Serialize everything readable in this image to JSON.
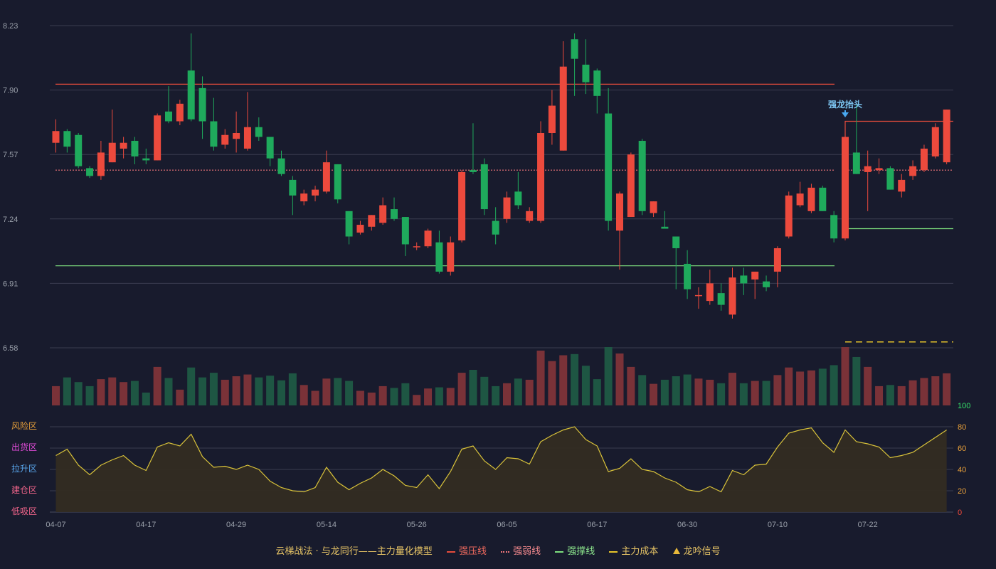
{
  "chart_data": {
    "type": "candlestick",
    "price_axis": {
      "ticks": [
        "8.23",
        "7.90",
        "7.57",
        "7.24",
        "6.91",
        "6.58"
      ],
      "range": [
        6.58,
        8.23
      ]
    },
    "x_ticks": [
      "04-07",
      "04-17",
      "04-29",
      "05-14",
      "05-26",
      "06-05",
      "06-17",
      "06-30",
      "07-10",
      "07-22"
    ],
    "x_tick_at_index": [
      0,
      8,
      16,
      24,
      32,
      40,
      48,
      56,
      64,
      72
    ],
    "candles": [
      [
        7.63,
        7.69,
        7.75,
        7.58
      ],
      [
        7.69,
        7.61,
        7.7,
        7.58
      ],
      [
        7.67,
        7.51,
        7.68,
        7.5
      ],
      [
        7.5,
        7.46,
        7.51,
        7.45
      ],
      [
        7.46,
        7.58,
        7.64,
        7.44
      ],
      [
        7.53,
        7.63,
        7.8,
        7.53
      ],
      [
        7.6,
        7.63,
        7.66,
        7.55
      ],
      [
        7.64,
        7.56,
        7.66,
        7.52
      ],
      [
        7.55,
        7.54,
        7.6,
        7.52
      ],
      [
        7.54,
        7.77,
        7.78,
        7.54
      ],
      [
        7.79,
        7.74,
        7.92,
        7.73
      ],
      [
        7.74,
        7.83,
        7.85,
        7.72
      ],
      [
        8.0,
        7.75,
        8.19,
        7.74
      ],
      [
        7.91,
        7.74,
        7.97,
        7.65
      ],
      [
        7.74,
        7.61,
        7.86,
        7.59
      ],
      [
        7.62,
        7.67,
        7.7,
        7.6
      ],
      [
        7.65,
        7.68,
        7.79,
        7.58
      ],
      [
        7.6,
        7.71,
        7.89,
        7.59
      ],
      [
        7.71,
        7.66,
        7.76,
        7.64
      ],
      [
        7.66,
        7.55,
        7.66,
        7.51
      ],
      [
        7.55,
        7.47,
        7.59,
        7.46
      ],
      [
        7.44,
        7.36,
        7.46,
        7.26
      ],
      [
        7.33,
        7.37,
        7.39,
        7.31
      ],
      [
        7.36,
        7.39,
        7.41,
        7.33
      ],
      [
        7.38,
        7.53,
        7.59,
        7.37
      ],
      [
        7.52,
        7.34,
        7.52,
        7.32
      ],
      [
        7.28,
        7.15,
        7.28,
        7.11
      ],
      [
        7.17,
        7.21,
        7.23,
        7.16
      ],
      [
        7.2,
        7.26,
        7.26,
        7.18
      ],
      [
        7.22,
        7.31,
        7.35,
        7.21
      ],
      [
        7.29,
        7.24,
        7.35,
        7.23
      ],
      [
        7.25,
        7.11,
        7.25,
        7.05
      ],
      [
        7.1,
        7.1,
        7.12,
        7.08
      ],
      [
        7.1,
        7.18,
        7.19,
        7.09
      ],
      [
        7.12,
        6.97,
        7.18,
        6.96
      ],
      [
        6.97,
        7.12,
        7.15,
        6.95
      ],
      [
        7.13,
        7.48,
        7.49,
        7.12
      ],
      [
        7.49,
        7.48,
        7.73,
        7.47
      ],
      [
        7.52,
        7.29,
        7.55,
        7.26
      ],
      [
        7.23,
        7.16,
        7.3,
        7.11
      ],
      [
        7.24,
        7.35,
        7.38,
        7.22
      ],
      [
        7.38,
        7.31,
        7.48,
        7.29
      ],
      [
        7.23,
        7.28,
        7.3,
        7.22
      ],
      [
        7.23,
        7.68,
        7.74,
        7.22
      ],
      [
        7.68,
        7.82,
        7.9,
        7.62
      ],
      [
        7.59,
        8.02,
        8.15,
        7.59
      ],
      [
        8.16,
        8.06,
        8.19,
        7.87
      ],
      [
        8.03,
        7.94,
        8.16,
        7.88
      ],
      [
        8.0,
        7.87,
        8.01,
        7.78
      ],
      [
        7.78,
        7.23,
        7.91,
        7.18
      ],
      [
        7.18,
        7.37,
        7.38,
        6.98
      ],
      [
        7.25,
        7.57,
        7.58,
        7.25
      ],
      [
        7.64,
        7.28,
        7.65,
        7.26
      ],
      [
        7.27,
        7.33,
        7.33,
        7.25
      ],
      [
        7.2,
        7.19,
        7.28,
        7.19
      ],
      [
        7.15,
        7.09,
        7.15,
        6.88
      ],
      [
        7.01,
        6.88,
        7.08,
        6.83
      ],
      [
        6.85,
        6.85,
        6.89,
        6.78
      ],
      [
        6.82,
        6.91,
        6.98,
        6.8
      ],
      [
        6.86,
        6.8,
        6.91,
        6.77
      ],
      [
        6.75,
        6.94,
        6.99,
        6.73
      ],
      [
        6.95,
        6.91,
        6.99,
        6.85
      ],
      [
        6.93,
        6.97,
        6.97,
        6.83
      ],
      [
        6.92,
        6.89,
        6.95,
        6.87
      ],
      [
        6.97,
        7.09,
        7.1,
        6.89
      ],
      [
        7.15,
        7.36,
        7.38,
        7.14
      ],
      [
        7.31,
        7.37,
        7.43,
        7.3
      ],
      [
        7.28,
        7.4,
        7.42,
        7.27
      ],
      [
        7.4,
        7.28,
        7.41,
        7.28
      ],
      [
        7.26,
        7.14,
        7.28,
        7.12
      ],
      [
        7.14,
        7.66,
        7.68,
        7.13
      ],
      [
        7.58,
        7.47,
        7.83,
        7.47
      ],
      [
        7.48,
        7.51,
        7.59,
        7.28
      ],
      [
        7.49,
        7.5,
        7.55,
        7.47
      ],
      [
        7.5,
        7.39,
        7.51,
        7.39
      ],
      [
        7.38,
        7.44,
        7.47,
        7.35
      ],
      [
        7.46,
        7.51,
        7.54,
        7.44
      ],
      [
        7.49,
        7.6,
        7.62,
        7.48
      ],
      [
        7.56,
        7.71,
        7.73,
        7.55
      ],
      [
        7.53,
        7.8,
        7.8,
        7.52
      ]
    ],
    "volume": [
      0.33,
      0.48,
      0.4,
      0.33,
      0.45,
      0.48,
      0.4,
      0.42,
      0.22,
      0.66,
      0.47,
      0.27,
      0.65,
      0.48,
      0.56,
      0.44,
      0.5,
      0.53,
      0.48,
      0.51,
      0.43,
      0.55,
      0.35,
      0.25,
      0.46,
      0.47,
      0.42,
      0.25,
      0.22,
      0.33,
      0.3,
      0.38,
      0.18,
      0.29,
      0.31,
      0.3,
      0.56,
      0.61,
      0.49,
      0.33,
      0.38,
      0.46,
      0.44,
      0.94,
      0.76,
      0.86,
      0.88,
      0.68,
      0.45,
      1.0,
      0.89,
      0.66,
      0.52,
      0.37,
      0.44,
      0.5,
      0.53,
      0.46,
      0.44,
      0.38,
      0.56,
      0.38,
      0.42,
      0.42,
      0.52,
      0.65,
      0.58,
      0.6,
      0.63,
      0.69,
      1.0,
      0.83,
      0.66,
      0.33,
      0.35,
      0.33,
      0.43,
      0.47,
      0.5,
      0.55
    ],
    "indicator": {
      "range": [
        0,
        100
      ],
      "right_ticks": [
        "0",
        "20",
        "40",
        "60",
        "80",
        "100"
      ],
      "zones": [
        "低吸区",
        "建仓区",
        "拉升区",
        "出货区",
        "风险区"
      ],
      "values": [
        53,
        59,
        44,
        35,
        44,
        49,
        53,
        44,
        39,
        61,
        65,
        62,
        73,
        52,
        42,
        43,
        40,
        44,
        40,
        29,
        23,
        20,
        19,
        23,
        42,
        28,
        21,
        27,
        32,
        40,
        34,
        25,
        23,
        35,
        22,
        38,
        59,
        62,
        48,
        40,
        51,
        50,
        45,
        66,
        72,
        77,
        80,
        68,
        62,
        38,
        41,
        50,
        40,
        38,
        32,
        28,
        21,
        19,
        24,
        19,
        39,
        35,
        44,
        45,
        61,
        74,
        77,
        79,
        65,
        56,
        77,
        66,
        64,
        61,
        51,
        53,
        56,
        63,
        70,
        77
      ],
      "line_color": "#d9c33a",
      "fill_color": "#332c22"
    },
    "levels": {
      "strong_pressure": {
        "label": "强压线",
        "value": 7.93,
        "color": "#e74c3c"
      },
      "strong_weak": {
        "label": "强弱线",
        "value": 7.49,
        "color": "#f0767a"
      },
      "strong_support": {
        "label": "强撑线",
        "value": 7.0,
        "color": "#7ee07e"
      },
      "cost": {
        "label": "主力成本",
        "value": 6.61,
        "color": "#e8c52a"
      }
    },
    "signal": {
      "text": "强龙抬头",
      "index": 70
    },
    "colors": {
      "up": "#ec4a3d",
      "down": "#1faa5c",
      "vol_up": "#7a3238",
      "vol_down": "#1e5643",
      "grid": "#3a3d50",
      "axis_text": "#9aa0aa",
      "bg": "#181b2d"
    }
  },
  "legend": {
    "title": "云梯战法 · 与龙同行——主力量化模型",
    "items": [
      {
        "label": "强压线",
        "color": "#e74c3c",
        "style": "solid"
      },
      {
        "label": "强弱线",
        "color": "#f0767a",
        "style": "dotted"
      },
      {
        "label": "强撑线",
        "color": "#7ee07e",
        "style": "solid"
      },
      {
        "label": "主力成本",
        "color": "#e8c52a",
        "style": "dashed"
      },
      {
        "label": "龙吟信号",
        "color": "#e8b93a",
        "style": "triangle"
      }
    ]
  }
}
